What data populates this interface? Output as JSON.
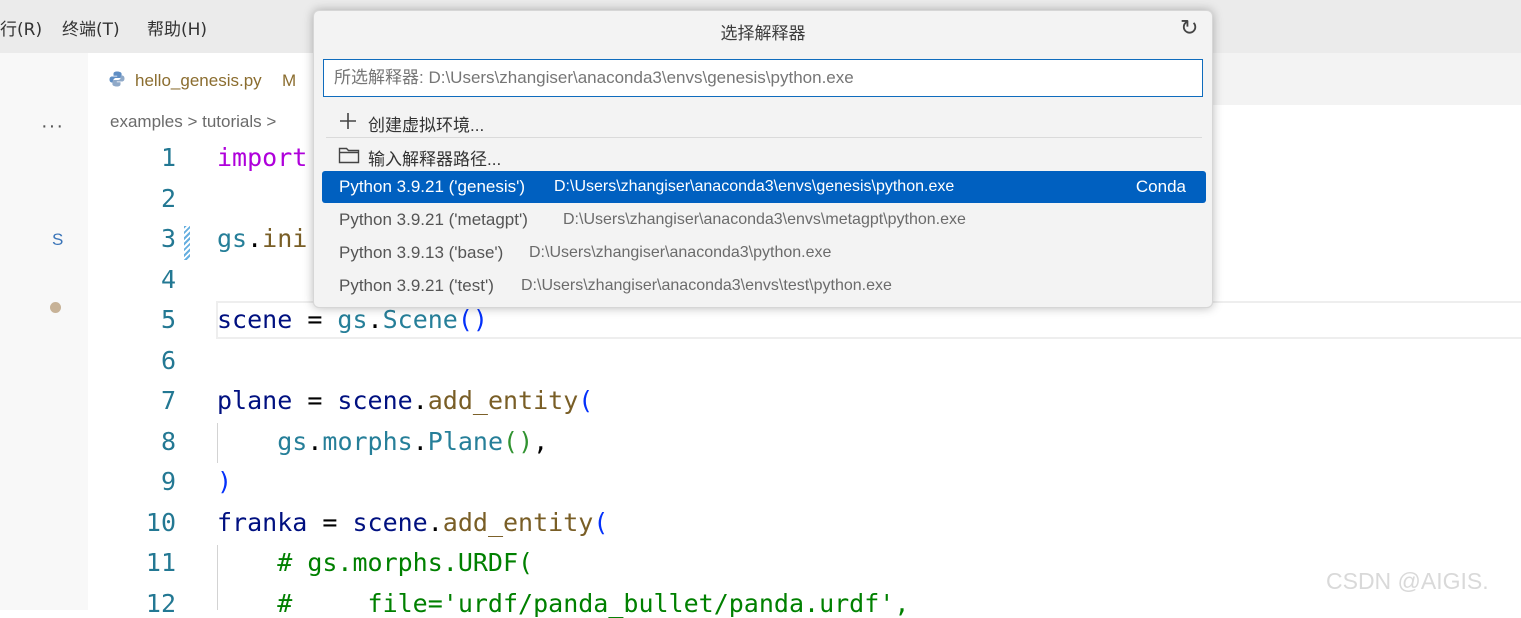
{
  "menu": [
    "行(R)",
    "终端(T)",
    "帮助(H)"
  ],
  "activity": {
    "more": "···",
    "letter": "S"
  },
  "tab": {
    "filename": "hello_genesis.py",
    "modified": "M"
  },
  "breadcrumb": "examples > tutorials >",
  "quickpick": {
    "title": "选择解释器",
    "placeholder": "所选解释器: D:\\Users\\zhangiser\\anaconda3\\envs\\genesis\\python.exe",
    "create_env": "创建虚拟环境...",
    "enter_path": "输入解释器路径...",
    "interpreters": [
      {
        "name": "Python 3.9.21 ('genesis')",
        "path": "D:\\Users\\zhangiser\\anaconda3\\envs\\genesis\\python.exe",
        "badge": "Conda"
      },
      {
        "name": "Python 3.9.21 ('metagpt')",
        "path": "D:\\Users\\zhangiser\\anaconda3\\envs\\metagpt\\python.exe"
      },
      {
        "name": "Python 3.9.13 ('base')",
        "path": "D:\\Users\\zhangiser\\anaconda3\\python.exe"
      },
      {
        "name": "Python 3.9.21 ('test')",
        "path": "D:\\Users\\zhangiser\\anaconda3\\envs\\test\\python.exe"
      }
    ]
  },
  "editor": {
    "line_numbers": [
      "1",
      "2",
      "3",
      "4",
      "5",
      "6",
      "7",
      "8",
      "9",
      "10",
      "11",
      "12"
    ],
    "code": {
      "l1_import": "import",
      "l3_a": "gs",
      "l3_b": ".",
      "l3_c": "ini",
      "l5_a": "scene",
      "l5_b": " = ",
      "l5_c": "gs",
      "l5_d": ".",
      "l5_e": "Scene",
      "l5_f": "()",
      "l7_a": "plane",
      "l7_b": " = ",
      "l7_c": "scene",
      "l7_d": ".",
      "l7_e": "add_entity",
      "l7_f": "(",
      "l8_a": "gs",
      "l8_b": ".",
      "l8_c": "morphs",
      "l8_d": ".",
      "l8_e": "Plane",
      "l8_f": "()",
      "l8_g": ",",
      "l9": ")",
      "l10_a": "franka",
      "l10_b": " = ",
      "l10_c": "scene",
      "l10_d": ".",
      "l10_e": "add_entity",
      "l10_f": "(",
      "l11": "# gs.morphs.URDF(",
      "l12": "#     file='urdf/panda_bullet/panda.urdf',"
    }
  },
  "watermark": "CSDN @AIGIS.",
  "colors": {
    "accent": "#0060c0",
    "input_border": "#0f6cbd",
    "line_number": "#237893"
  }
}
